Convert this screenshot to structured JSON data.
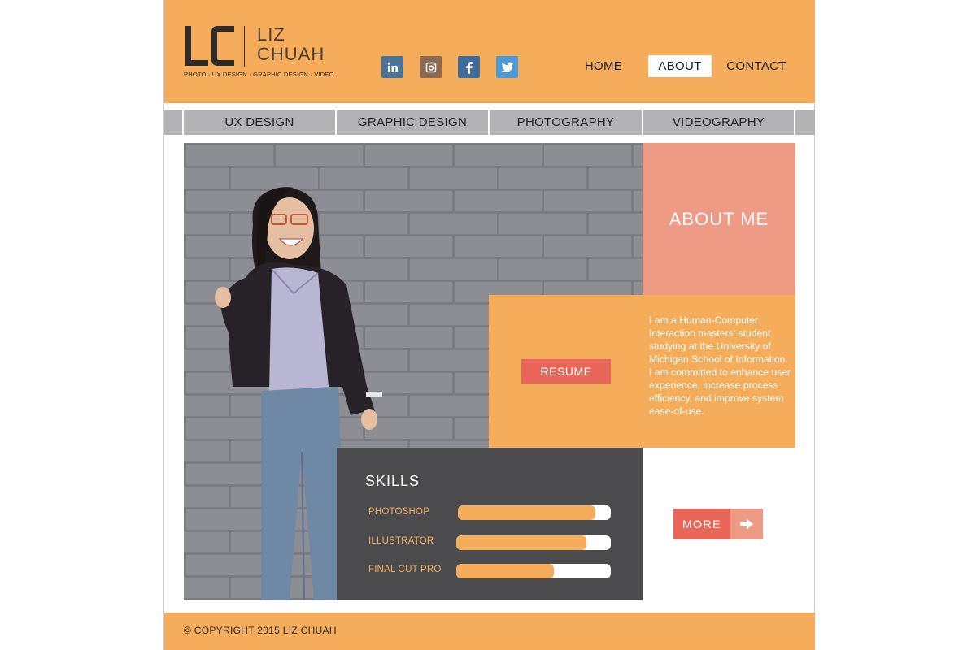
{
  "brand": {
    "monogram": "LC",
    "first_name": "LIZ",
    "last_name": "CHUAH",
    "tagline": "PHOTO · UX DESIGN · GRAPHIC DESIGN · VIDEO"
  },
  "social": [
    {
      "name": "linkedin",
      "icon": "linkedin-icon"
    },
    {
      "name": "instagram",
      "icon": "instagram-icon"
    },
    {
      "name": "facebook",
      "icon": "facebook-icon"
    },
    {
      "name": "twitter",
      "icon": "twitter-icon"
    }
  ],
  "nav": {
    "home": "HOME",
    "about": "ABOUT",
    "contact": "CONTACT",
    "active": "about"
  },
  "categories": {
    "ux": "UX DESIGN",
    "graphic": "GRAPHIC DESIGN",
    "photography": "PHOTOGRAPHY",
    "videography": "VIDEOGRAPHY"
  },
  "about": {
    "title": "ABOUT ME",
    "resume_label": "RESUME",
    "bio": "I am a Human-Computer Interaction masters' student studying at the University of Michigan School of Information. I am committed to enhance user experience, increase process efficiency, and improve system ease-of-use."
  },
  "skills": {
    "title": "SKILLS",
    "items": [
      {
        "label": "PHOTOSHOP",
        "level": 0.9
      },
      {
        "label": "ILLUSTRATOR",
        "level": 0.84
      },
      {
        "label": "FINAL CUT PRO",
        "level": 0.63
      }
    ]
  },
  "more": {
    "label": "MORE",
    "icon": "arrow-right-icon"
  },
  "footer": {
    "copyright": "© COPYRIGHT 2015 LIZ CHUAH"
  },
  "colors": {
    "primary_orange": "#f5ad5b",
    "salmon": "#ef9a85",
    "coral": "#e8675a",
    "charcoal": "#4b4b4d",
    "gray_tab": "#b3b3b5"
  }
}
